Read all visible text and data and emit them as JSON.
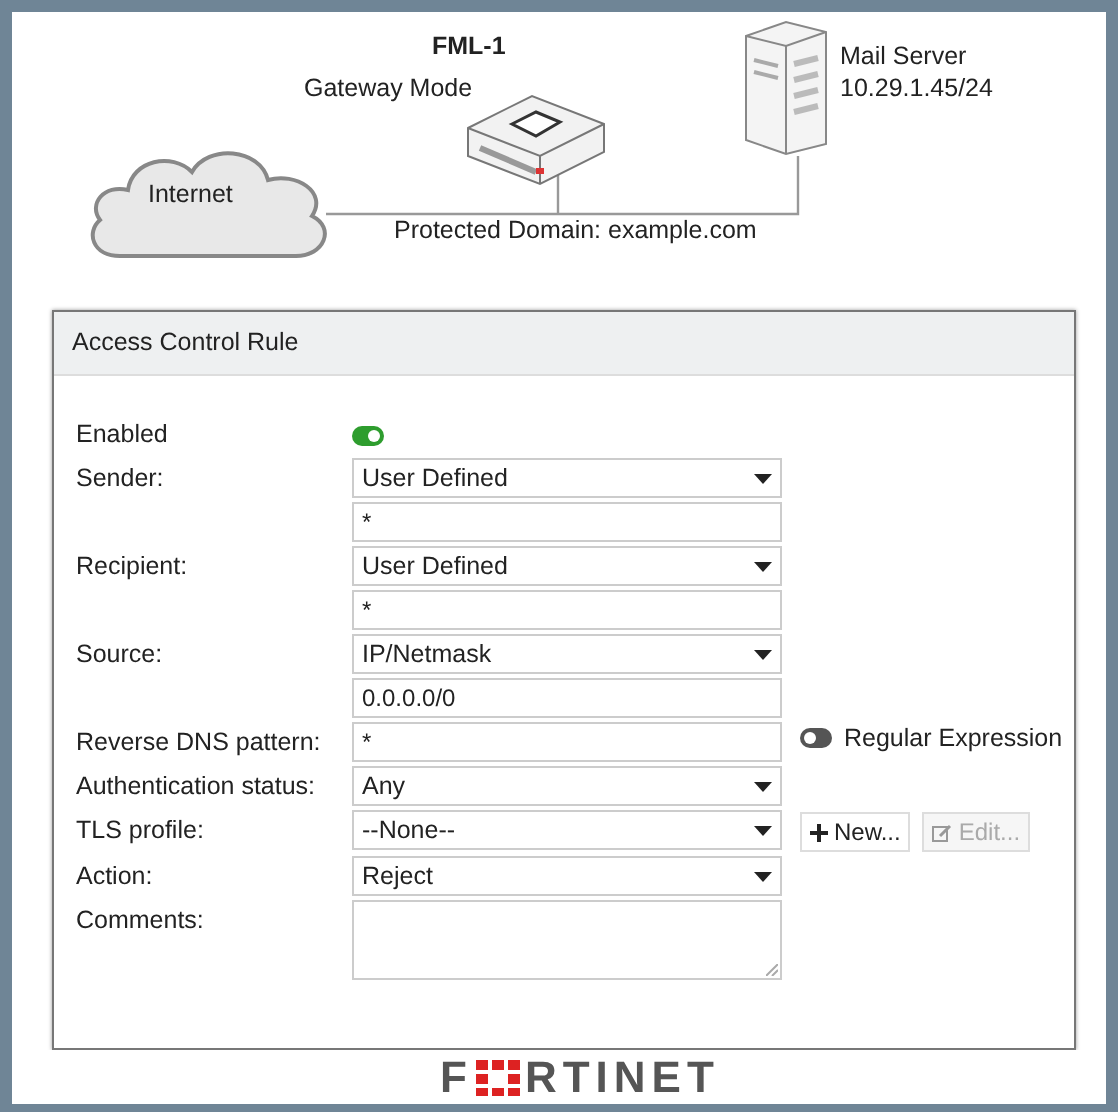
{
  "diagram": {
    "device_name": "FML-1",
    "device_mode": "Gateway Mode",
    "server_name": "Mail Server",
    "server_address": "10.29.1.45/24",
    "cloud_label": "Internet",
    "domain_label": "Protected Domain: example.com"
  },
  "panel": {
    "title": "Access Control Rule",
    "rows": [
      {
        "kind": "toggle",
        "label": "Enabled",
        "on": true
      },
      {
        "kind": "select",
        "label": "Sender:",
        "value": "User Defined"
      },
      {
        "kind": "input",
        "value": "*"
      },
      {
        "kind": "select",
        "label": "Recipient:",
        "value": "User Defined"
      },
      {
        "kind": "input",
        "value": "*"
      },
      {
        "kind": "select",
        "label": "Source:",
        "value": "IP/Netmask"
      },
      {
        "kind": "input",
        "value": "0.0.0.0/0"
      },
      {
        "kind": "input",
        "label": "Reverse DNS pattern:",
        "value": "*",
        "extra_toggle": {
          "label": "Regular Expression",
          "on": false
        }
      },
      {
        "kind": "select",
        "label": "Authentication status:",
        "value": "Any"
      },
      {
        "kind": "select",
        "label": "TLS profile:",
        "value": "--None--",
        "buttons": [
          {
            "label": "New...",
            "kind": "new",
            "disabled": false
          },
          {
            "label": "Edit...",
            "kind": "edit",
            "disabled": true
          }
        ]
      },
      {
        "kind": "select",
        "label": "Action:",
        "value": "Reject"
      },
      {
        "kind": "textarea",
        "label": "Comments:"
      }
    ]
  },
  "footer": {
    "logo_start": "F",
    "logo_end": "RTINET"
  }
}
